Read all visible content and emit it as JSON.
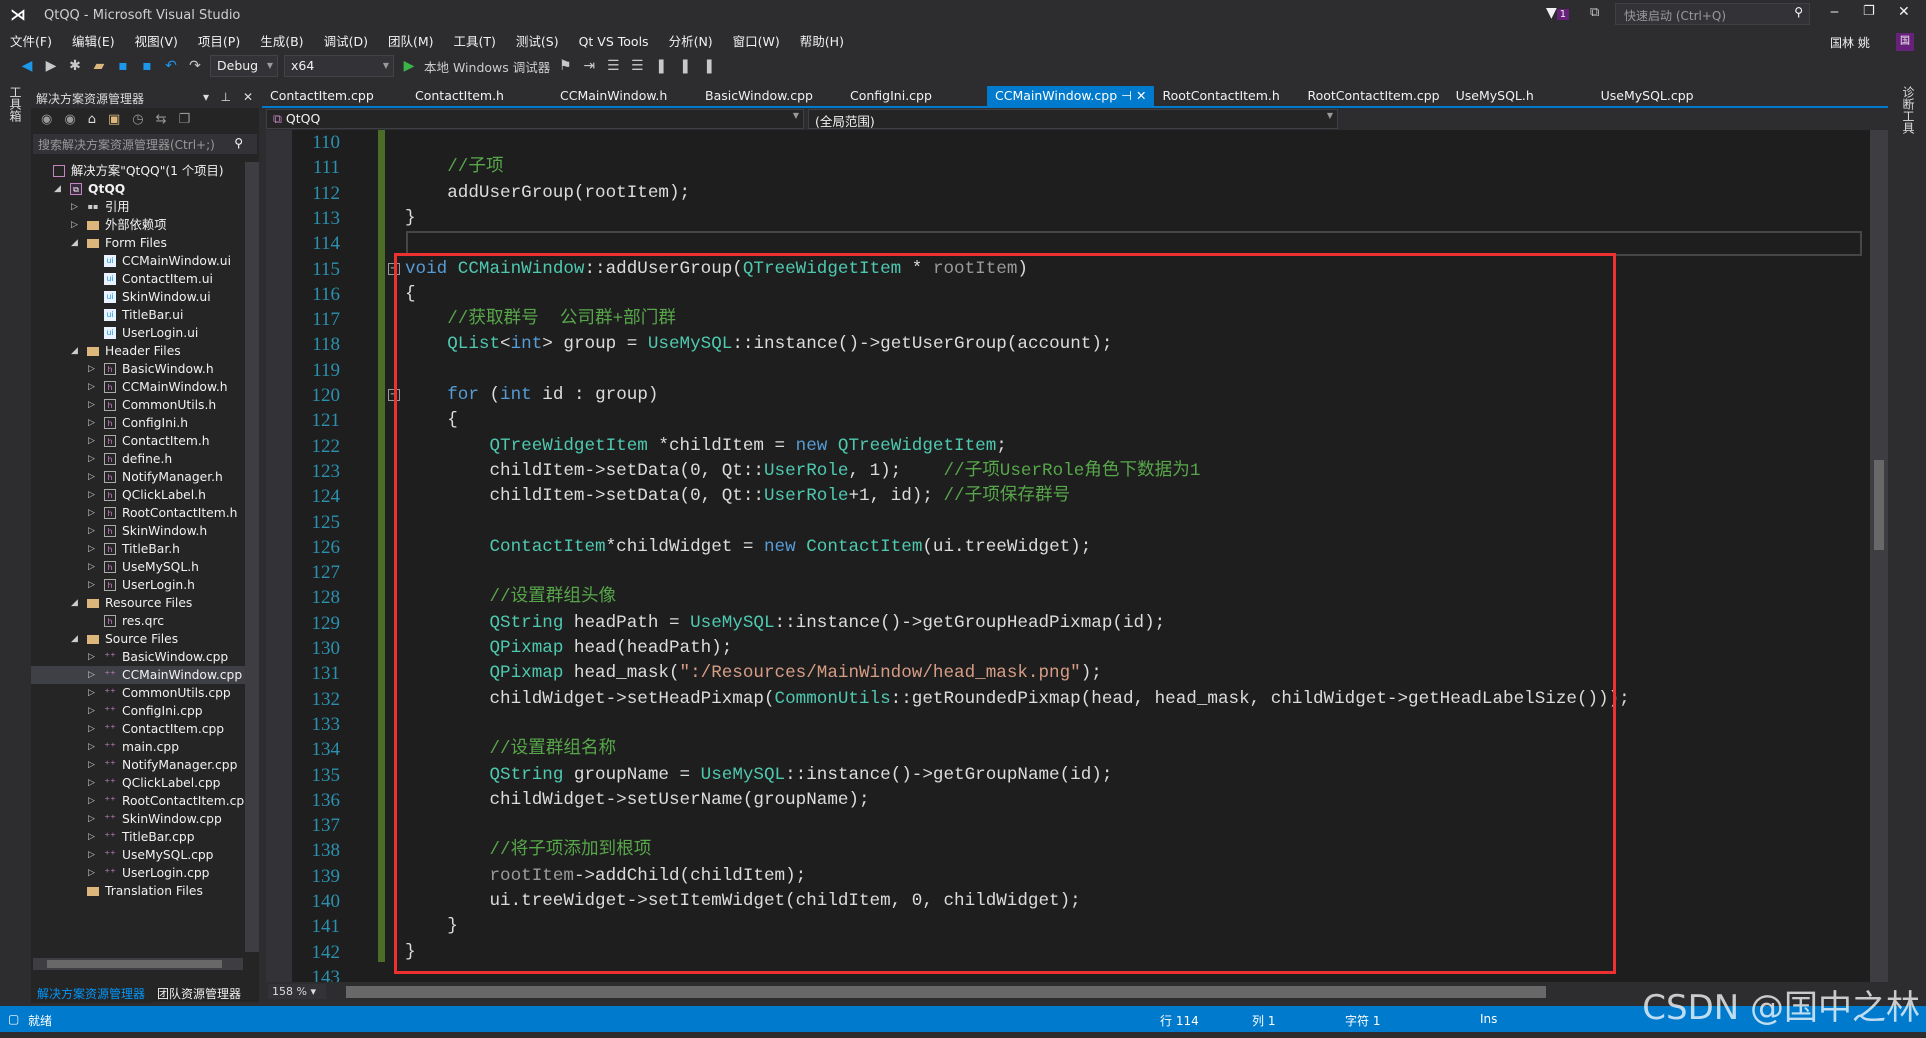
{
  "window": {
    "title": "QtQQ - Microsoft Visual Studio",
    "quick_launch": "快速启动 (Ctrl+Q)",
    "notifications": "1",
    "user": "国林 姚",
    "user_badge": "国"
  },
  "menu": [
    "文件(F)",
    "编辑(E)",
    "视图(V)",
    "项目(P)",
    "生成(B)",
    "调试(D)",
    "团队(M)",
    "工具(T)",
    "测试(S)",
    "Qt VS Tools",
    "分析(N)",
    "窗口(W)",
    "帮助(H)"
  ],
  "toolbar": {
    "config": "Debug",
    "platform": "x64",
    "debugger": "本地 Windows 调试器"
  },
  "left_strip": "工具箱",
  "right_strip": "诊断工具",
  "solution_explorer": {
    "title": "解决方案资源管理器",
    "search_placeholder": "搜索解决方案资源管理器(Ctrl+;)",
    "items": [
      {
        "label": "解决方案\"QtQQ\"(1 个项目)",
        "depth": 0,
        "icon": "sol",
        "exp": ""
      },
      {
        "label": "QtQQ",
        "depth": 1,
        "icon": "proj",
        "exp": "open",
        "bold": true
      },
      {
        "label": "引用",
        "depth": 2,
        "icon": "ref",
        "exp": "closed"
      },
      {
        "label": "外部依赖项",
        "depth": 2,
        "icon": "folder",
        "exp": "closed"
      },
      {
        "label": "Form Files",
        "depth": 2,
        "icon": "folder",
        "exp": "open"
      },
      {
        "label": "CCMainWindow.ui",
        "depth": 3,
        "icon": "ui",
        "exp": ""
      },
      {
        "label": "ContactItem.ui",
        "depth": 3,
        "icon": "ui",
        "exp": ""
      },
      {
        "label": "SkinWindow.ui",
        "depth": 3,
        "icon": "ui",
        "exp": ""
      },
      {
        "label": "TitleBar.ui",
        "depth": 3,
        "icon": "ui",
        "exp": ""
      },
      {
        "label": "UserLogin.ui",
        "depth": 3,
        "icon": "ui",
        "exp": ""
      },
      {
        "label": "Header Files",
        "depth": 2,
        "icon": "folder",
        "exp": "open"
      },
      {
        "label": "BasicWindow.h",
        "depth": 3,
        "icon": "h",
        "exp": "closed"
      },
      {
        "label": "CCMainWindow.h",
        "depth": 3,
        "icon": "h",
        "exp": "closed"
      },
      {
        "label": "CommonUtils.h",
        "depth": 3,
        "icon": "h",
        "exp": "closed"
      },
      {
        "label": "ConfigIni.h",
        "depth": 3,
        "icon": "h",
        "exp": "closed"
      },
      {
        "label": "ContactItem.h",
        "depth": 3,
        "icon": "h",
        "exp": "closed"
      },
      {
        "label": "define.h",
        "depth": 3,
        "icon": "h",
        "exp": "closed"
      },
      {
        "label": "NotifyManager.h",
        "depth": 3,
        "icon": "h",
        "exp": "closed"
      },
      {
        "label": "QClickLabel.h",
        "depth": 3,
        "icon": "h",
        "exp": "closed"
      },
      {
        "label": "RootContactItem.h",
        "depth": 3,
        "icon": "h",
        "exp": "closed"
      },
      {
        "label": "SkinWindow.h",
        "depth": 3,
        "icon": "h",
        "exp": "closed"
      },
      {
        "label": "TitleBar.h",
        "depth": 3,
        "icon": "h",
        "exp": "closed"
      },
      {
        "label": "UseMySQL.h",
        "depth": 3,
        "icon": "h",
        "exp": "closed"
      },
      {
        "label": "UserLogin.h",
        "depth": 3,
        "icon": "h",
        "exp": "closed"
      },
      {
        "label": "Resource Files",
        "depth": 2,
        "icon": "folder",
        "exp": "open"
      },
      {
        "label": "res.qrc",
        "depth": 3,
        "icon": "h",
        "exp": ""
      },
      {
        "label": "Source Files",
        "depth": 2,
        "icon": "folder",
        "exp": "open"
      },
      {
        "label": "BasicWindow.cpp",
        "depth": 3,
        "icon": "cpp",
        "exp": "closed"
      },
      {
        "label": "CCMainWindow.cpp",
        "depth": 3,
        "icon": "cpp",
        "exp": "closed",
        "selected": true
      },
      {
        "label": "CommonUtils.cpp",
        "depth": 3,
        "icon": "cpp",
        "exp": "closed"
      },
      {
        "label": "ConfigIni.cpp",
        "depth": 3,
        "icon": "cpp",
        "exp": "closed"
      },
      {
        "label": "ContactItem.cpp",
        "depth": 3,
        "icon": "cpp",
        "exp": "closed"
      },
      {
        "label": "main.cpp",
        "depth": 3,
        "icon": "cpp",
        "exp": "closed"
      },
      {
        "label": "NotifyManager.cpp",
        "depth": 3,
        "icon": "cpp",
        "exp": "closed"
      },
      {
        "label": "QClickLabel.cpp",
        "depth": 3,
        "icon": "cpp",
        "exp": "closed"
      },
      {
        "label": "RootContactItem.cpp",
        "depth": 3,
        "icon": "cpp",
        "exp": "closed"
      },
      {
        "label": "SkinWindow.cpp",
        "depth": 3,
        "icon": "cpp",
        "exp": "closed"
      },
      {
        "label": "TitleBar.cpp",
        "depth": 3,
        "icon": "cpp",
        "exp": "closed"
      },
      {
        "label": "UseMySQL.cpp",
        "depth": 3,
        "icon": "cpp",
        "exp": "closed"
      },
      {
        "label": "UserLogin.cpp",
        "depth": 3,
        "icon": "cpp",
        "exp": "closed"
      },
      {
        "label": "Translation Files",
        "depth": 2,
        "icon": "folder",
        "exp": ""
      }
    ],
    "bottom_tabs": [
      "解决方案资源管理器",
      "团队资源管理器"
    ]
  },
  "tabs": [
    {
      "label": "ContactItem.cpp"
    },
    {
      "label": "ContactItem.h"
    },
    {
      "label": "CCMainWindow.h"
    },
    {
      "label": "BasicWindow.cpp"
    },
    {
      "label": "ConfigIni.cpp"
    },
    {
      "label": "CCMainWindow.cpp",
      "active": true
    },
    {
      "label": "RootContactItem.h"
    },
    {
      "label": "RootContactItem.cpp"
    },
    {
      "label": "UseMySQL.h"
    },
    {
      "label": "UseMySQL.cpp"
    }
  ],
  "navbar": {
    "project": "QtQQ",
    "scope": "(全局范围)"
  },
  "editor": {
    "zoom": "158 %",
    "current_line": 114,
    "colors": {
      "keyword": "#569cd6",
      "type": "#4ec9b0",
      "comment": "#57a64a",
      "string": "#d69d85",
      "param": "#9a9a9a",
      "text": "#dcdcdc",
      "line_number": "#2b91af",
      "highlight_box": "#ee3030"
    },
    "folds": [
      115,
      120
    ],
    "lines": [
      {
        "n": 110,
        "tk": []
      },
      {
        "n": 111,
        "tk": [
          [
            "d",
            "    "
          ],
          [
            "c",
            "//子项"
          ]
        ]
      },
      {
        "n": 112,
        "tk": [
          [
            "d",
            "    addUserGroup(rootItem);"
          ]
        ]
      },
      {
        "n": 113,
        "tk": [
          [
            "d",
            "}"
          ]
        ]
      },
      {
        "n": 114,
        "tk": []
      },
      {
        "n": 115,
        "tk": [
          [
            "k",
            "void"
          ],
          [
            "d",
            " "
          ],
          [
            "t",
            "CCMainWindow"
          ],
          [
            "d",
            "::addUserGroup("
          ],
          [
            "t",
            "QTreeWidgetItem"
          ],
          [
            "d",
            " * "
          ],
          [
            "p",
            "rootItem"
          ],
          [
            "d",
            ")"
          ]
        ]
      },
      {
        "n": 116,
        "tk": [
          [
            "d",
            "{"
          ]
        ]
      },
      {
        "n": 117,
        "tk": [
          [
            "d",
            "    "
          ],
          [
            "c",
            "//获取群号  公司群+部门群"
          ]
        ]
      },
      {
        "n": 118,
        "tk": [
          [
            "d",
            "    "
          ],
          [
            "t",
            "QList"
          ],
          [
            "d",
            "<"
          ],
          [
            "k",
            "int"
          ],
          [
            "d",
            "> group = "
          ],
          [
            "t",
            "UseMySQL"
          ],
          [
            "d",
            "::instance()->getUserGroup(account);"
          ]
        ]
      },
      {
        "n": 119,
        "tk": []
      },
      {
        "n": 120,
        "tk": [
          [
            "d",
            "    "
          ],
          [
            "k",
            "for"
          ],
          [
            "d",
            " ("
          ],
          [
            "k",
            "int"
          ],
          [
            "d",
            " id : group)"
          ]
        ]
      },
      {
        "n": 121,
        "tk": [
          [
            "d",
            "    {"
          ]
        ]
      },
      {
        "n": 122,
        "tk": [
          [
            "d",
            "        "
          ],
          [
            "t",
            "QTreeWidgetItem"
          ],
          [
            "d",
            " *childItem = "
          ],
          [
            "k",
            "new"
          ],
          [
            "d",
            " "
          ],
          [
            "t",
            "QTreeWidgetItem"
          ],
          [
            "d",
            ";"
          ]
        ]
      },
      {
        "n": 123,
        "tk": [
          [
            "d",
            "        childItem->setData(0, Qt::"
          ],
          [
            "t",
            "UserRole"
          ],
          [
            "d",
            ", 1);    "
          ],
          [
            "c",
            "//子项UserRole角色下数据为1"
          ]
        ]
      },
      {
        "n": 124,
        "tk": [
          [
            "d",
            "        childItem->setData(0, Qt::"
          ],
          [
            "t",
            "UserRole"
          ],
          [
            "d",
            "+1, id); "
          ],
          [
            "c",
            "//子项保存群号"
          ]
        ]
      },
      {
        "n": 125,
        "tk": []
      },
      {
        "n": 126,
        "tk": [
          [
            "d",
            "        "
          ],
          [
            "t",
            "ContactItem"
          ],
          [
            "d",
            "*childWidget = "
          ],
          [
            "k",
            "new"
          ],
          [
            "d",
            " "
          ],
          [
            "t",
            "ContactItem"
          ],
          [
            "d",
            "(ui.treeWidget);"
          ]
        ]
      },
      {
        "n": 127,
        "tk": []
      },
      {
        "n": 128,
        "tk": [
          [
            "d",
            "        "
          ],
          [
            "c",
            "//设置群组头像"
          ]
        ]
      },
      {
        "n": 129,
        "tk": [
          [
            "d",
            "        "
          ],
          [
            "t",
            "QString"
          ],
          [
            "d",
            " headPath = "
          ],
          [
            "t",
            "UseMySQL"
          ],
          [
            "d",
            "::instance()->getGroupHeadPixmap(id);"
          ]
        ]
      },
      {
        "n": 130,
        "tk": [
          [
            "d",
            "        "
          ],
          [
            "t",
            "QPixmap"
          ],
          [
            "d",
            " head(headPath);"
          ]
        ]
      },
      {
        "n": 131,
        "tk": [
          [
            "d",
            "        "
          ],
          [
            "t",
            "QPixmap"
          ],
          [
            "d",
            " head_mask("
          ],
          [
            "s",
            "\":/Resources/MainWindow/head_mask.png\""
          ],
          [
            "d",
            ");"
          ]
        ]
      },
      {
        "n": 132,
        "tk": [
          [
            "d",
            "        childWidget->setHeadPixmap("
          ],
          [
            "t",
            "CommonUtils"
          ],
          [
            "d",
            "::getRoundedPixmap(head, head_mask, childWidget->getHeadLabelSize()));"
          ]
        ]
      },
      {
        "n": 133,
        "tk": []
      },
      {
        "n": 134,
        "tk": [
          [
            "d",
            "        "
          ],
          [
            "c",
            "//设置群组名称"
          ]
        ]
      },
      {
        "n": 135,
        "tk": [
          [
            "d",
            "        "
          ],
          [
            "t",
            "QString"
          ],
          [
            "d",
            " groupName = "
          ],
          [
            "t",
            "UseMySQL"
          ],
          [
            "d",
            "::instance()->getGroupName(id);"
          ]
        ]
      },
      {
        "n": 136,
        "tk": [
          [
            "d",
            "        childWidget->setUserName(groupName);"
          ]
        ]
      },
      {
        "n": 137,
        "tk": []
      },
      {
        "n": 138,
        "tk": [
          [
            "d",
            "        "
          ],
          [
            "c",
            "//将子项添加到根项"
          ]
        ]
      },
      {
        "n": 139,
        "tk": [
          [
            "d",
            "        "
          ],
          [
            "p",
            "rootItem"
          ],
          [
            "d",
            "->addChild(childItem);"
          ]
        ]
      },
      {
        "n": 140,
        "tk": [
          [
            "d",
            "        ui.treeWidget->setItemWidget(childItem, 0, childWidget);"
          ]
        ]
      },
      {
        "n": 141,
        "tk": [
          [
            "d",
            "    }"
          ]
        ]
      },
      {
        "n": 142,
        "tk": [
          [
            "d",
            "}"
          ]
        ]
      },
      {
        "n": 143,
        "tk": []
      }
    ]
  },
  "status": {
    "ready": "就绪",
    "row": "行 114",
    "col": "列 1",
    "char": "字符 1",
    "mode": "Ins"
  },
  "watermark": "CSDN @国中之林"
}
